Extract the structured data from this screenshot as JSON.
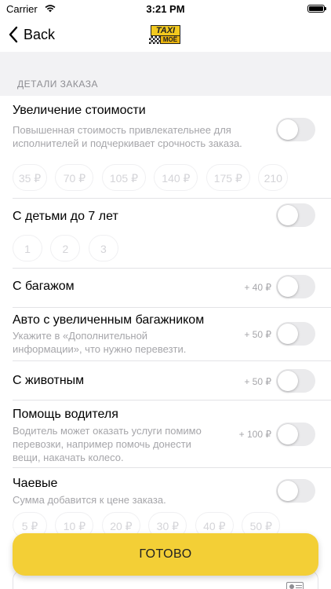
{
  "status_bar": {
    "carrier": "Carrier",
    "time": "3:21 PM"
  },
  "nav": {
    "back_label": "Back",
    "logo_top": "TAXI",
    "logo_bottom": "МОЁ"
  },
  "section": {
    "header": "ДЕТАЛИ ЗАКАЗА"
  },
  "options": [
    {
      "title": "Увеличение стоимости",
      "description": "Повышенная стоимость привлекательнее для исполнителей и подчеркивает срочность заказа.",
      "price": "",
      "enabled": false,
      "chips": [
        "35 ₽",
        "70 ₽",
        "105 ₽",
        "140 ₽",
        "175 ₽",
        "210"
      ]
    },
    {
      "title": "С детьми до 7 лет",
      "description": "",
      "price": "",
      "enabled": false,
      "chips": [
        "1",
        "2",
        "3"
      ]
    },
    {
      "title": "С багажом",
      "description": "",
      "price": "+ 40 ₽",
      "enabled": false
    },
    {
      "title": "Авто с увеличенным багажником",
      "description": "Укажите в «Дополнительной информации», что нужно перевезти.",
      "price": "+ 50 ₽",
      "enabled": false
    },
    {
      "title": "С животным",
      "description": "",
      "price": "+ 50 ₽",
      "enabled": false
    },
    {
      "title": "Помощь водителя",
      "description": "Водитель может оказать услуги помимо перевозки, например помочь донести вещи, накачать колесо.",
      "price": "+ 100 ₽",
      "enabled": false
    },
    {
      "title": "Чаевые",
      "description": "Сумма добавится к цене заказа.",
      "price": "",
      "enabled": false,
      "chips": [
        "5 ₽",
        "10 ₽",
        "20 ₽",
        "30 ₽",
        "40 ₽",
        "50 ₽"
      ]
    }
  ],
  "done_button": {
    "label": "ГОТОВО"
  },
  "colors": {
    "accent": "#f3cf36",
    "toggle_off": "#eaeaec",
    "secondary_text": "#a6a6aa"
  }
}
